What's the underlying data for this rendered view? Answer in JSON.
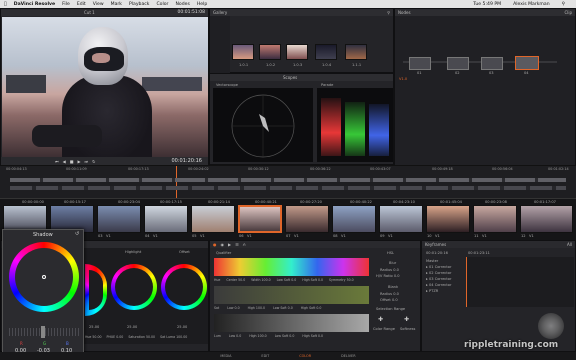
{
  "menubar": {
    "app": "DaVinci Resolve",
    "items": [
      "File",
      "Edit",
      "View",
      "Mark",
      "Playback",
      "Color",
      "Nodes",
      "Help"
    ],
    "clock": "Tue 5:49 PM",
    "user": "Alexis Markman"
  },
  "viewer": {
    "clip_name": "Cut 1",
    "timecode_top": "00:01:51:08",
    "timecode": "00:01:20:16"
  },
  "gallery": {
    "title": "Gallery",
    "stills": [
      "1.0.1",
      "1.0.2",
      "1.0.3",
      "1.0.4",
      "1.1.1"
    ]
  },
  "scopes": {
    "title": "Scopes",
    "vectorscope": "Vectorscope",
    "parade": "Parade"
  },
  "nodes": {
    "title": "Nodes",
    "clip_label": "Clip",
    "ver": "V1.0",
    "node_labels": [
      "01",
      "02",
      "03",
      "04"
    ]
  },
  "timeline": {
    "ruler": [
      "00:00:04:13",
      "00:00:11:09",
      "00:00:17:13",
      "00:00:24:02",
      "00:00:30:12",
      "00:00:36:22",
      "00:00:43:07",
      "00:00:49:18",
      "00:00:56:04",
      "00:01:02:14"
    ]
  },
  "clips": [
    {
      "tc": "00:00:00:00",
      "num": "01",
      "track": "V1"
    },
    {
      "tc": "00:00:15:17",
      "num": "02",
      "track": "V1"
    },
    {
      "tc": "00:00:23:04",
      "num": "03",
      "track": "V1"
    },
    {
      "tc": "00:00:17:15",
      "num": "04",
      "track": "V1"
    },
    {
      "tc": "00:00:21:14",
      "num": "05",
      "track": "V1"
    },
    {
      "tc": "00:00:40:21",
      "num": "06",
      "track": "V1"
    },
    {
      "tc": "00:00:27:20",
      "num": "07",
      "track": "V1"
    },
    {
      "tc": "00:00:40:22",
      "num": "08",
      "track": "V1"
    },
    {
      "tc": "00:04:23:10",
      "num": "09",
      "track": "V1"
    },
    {
      "tc": "00:01:45:04",
      "num": "10",
      "track": "V1"
    },
    {
      "tc": "00:00:23:08",
      "num": "11",
      "track": "V1"
    },
    {
      "tc": "00:01:17:07",
      "num": "12",
      "track": "V1"
    }
  ],
  "shadow_wheel": {
    "title": "Shadow",
    "values": [
      {
        "label": "R",
        "value": "0.00"
      },
      {
        "label": "G",
        "value": "-0.03"
      },
      {
        "label": "B",
        "value": "0.10"
      }
    ]
  },
  "wheels": {
    "labels": [
      "",
      "Highlight",
      "Offset"
    ],
    "values_a": [
      "25.00",
      "25.00",
      "25.00"
    ],
    "footer": [
      "Hue 50.00",
      "PHUE 0.00",
      "Saturation 50.00",
      "Sat Luma 100.00"
    ]
  },
  "qualifier": {
    "title": "Qualifier",
    "row1": {
      "label": "Hue",
      "center": "Center 50.0",
      "width": "Width 100.0",
      "low_soft": "Low Soft 0.0",
      "high_soft": "High Soft 0.0",
      "sym": "Symmetry 50.0"
    },
    "row2": {
      "label": "Sat",
      "low": "Low 0.0",
      "high": "High 100.0",
      "low_soft": "Low Soft 0.0",
      "high_soft": "High Soft 0.0"
    },
    "row3": {
      "label": "Lum",
      "low": "Low 0.0",
      "high": "High 100.0",
      "low_soft": "Low Soft 0.0",
      "high_soft": "High Soft 0.0"
    }
  },
  "matte": {
    "hsl": "HSL",
    "blur_title": "Blur",
    "blur_vals": [
      "Radius 0.0",
      "H/V Ratio 0.0"
    ],
    "blank_title": "Blank",
    "blank_vals": [
      "Radius 0.0",
      "Offset 0.0"
    ],
    "sel_title": "Selection Range",
    "sel_opts": [
      "Color Range",
      "Softness"
    ]
  },
  "keyframes": {
    "title": "Keyframes",
    "mode": "All",
    "tc1": "00:01:20:16",
    "tc2": "00:01:23:11",
    "tracks": [
      "Master",
      "Corrector",
      "Corrector",
      "Corrector",
      "Corrector",
      "PTZR"
    ],
    "prefixes": [
      "",
      "01",
      "02",
      "03",
      "04",
      ""
    ]
  },
  "pages": [
    "MEDIA",
    "EDIT",
    "COLOR",
    "DELIVER"
  ],
  "watermark": "rippletraining.com",
  "colors": {
    "accent": "#e0662a",
    "bg": "#1a1a1c",
    "panel": "#242428"
  }
}
